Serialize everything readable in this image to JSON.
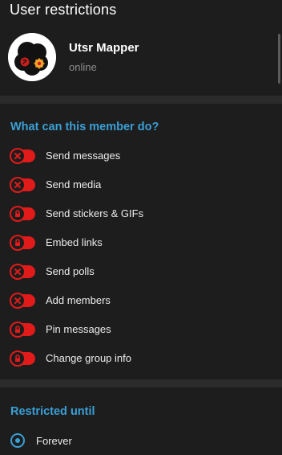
{
  "header": {
    "title": "User restrictions"
  },
  "member": {
    "name": "Utsr Mapper",
    "status": "online"
  },
  "permissions": {
    "section_title": "What can this member do?",
    "items": [
      {
        "label": "Send messages",
        "enabled": false,
        "icon": "close-icon"
      },
      {
        "label": "Send media",
        "enabled": false,
        "icon": "close-icon"
      },
      {
        "label": "Send stickers & GIFs",
        "enabled": false,
        "icon": "lock-icon"
      },
      {
        "label": "Embed links",
        "enabled": false,
        "icon": "lock-icon"
      },
      {
        "label": "Send polls",
        "enabled": false,
        "icon": "close-icon"
      },
      {
        "label": "Add members",
        "enabled": false,
        "icon": "close-icon"
      },
      {
        "label": "Pin messages",
        "enabled": false,
        "icon": "lock-icon"
      },
      {
        "label": "Change group info",
        "enabled": false,
        "icon": "lock-icon"
      }
    ]
  },
  "restricted_until": {
    "section_title": "Restricted until",
    "options": [
      {
        "label": "Forever",
        "selected": true
      }
    ]
  },
  "colors": {
    "background": "#1d1d1d",
    "divider": "#2b2b2b",
    "accent": "#3a9fd6",
    "toggle_off": "#e11a1a",
    "muted_text": "#8d8d8d"
  }
}
